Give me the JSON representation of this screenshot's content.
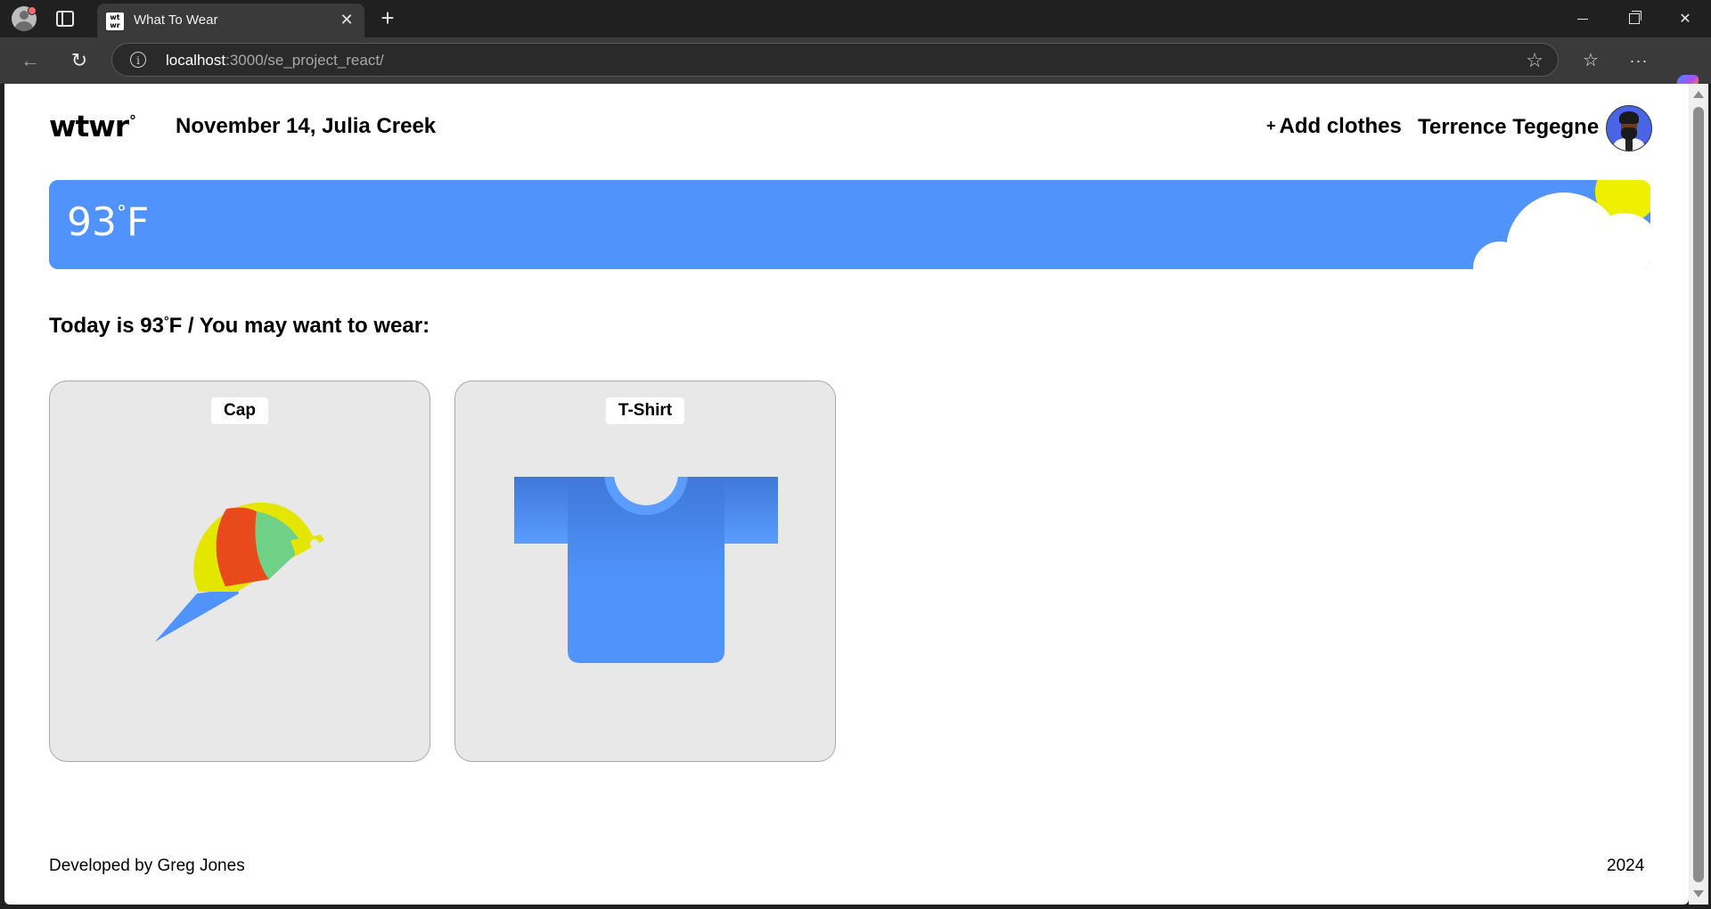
{
  "browser": {
    "tab": {
      "favicon_text": "wt wr",
      "title": "What To Wear"
    },
    "url": {
      "host": "localhost",
      "rest": ":3000/se_project_react/"
    },
    "icons": [
      "profile-icon",
      "tabs-icon",
      "close-icon",
      "plus-icon",
      "minimize-icon",
      "maximize-icon",
      "close-window-icon",
      "back-icon",
      "reload-icon",
      "info-icon",
      "star-icon",
      "favorites-icon",
      "more-icon",
      "copilot-icon"
    ]
  },
  "header": {
    "logo": "wtwr",
    "logo_degree": "°",
    "date_location": "November 14, Julia Creek",
    "add_clothes_plus": "+",
    "add_clothes_label": "Add clothes",
    "username": "Terrence Tegegne"
  },
  "weather": {
    "temp_value": "93",
    "temp_degree": "°",
    "temp_unit": "F",
    "colors": {
      "banner": "#5093fc",
      "sun": "#eef000",
      "cloud": "#ffffff"
    }
  },
  "recommendation": {
    "prefix": "Today is 93",
    "degree": "°",
    "suffix": "F / You may want to wear:"
  },
  "items": [
    {
      "name": "Cap",
      "icon": "cap-icon"
    },
    {
      "name": "T-Shirt",
      "icon": "tshirt-icon"
    }
  ],
  "footer": {
    "credit": "Developed by Greg Jones",
    "year": "2024"
  }
}
